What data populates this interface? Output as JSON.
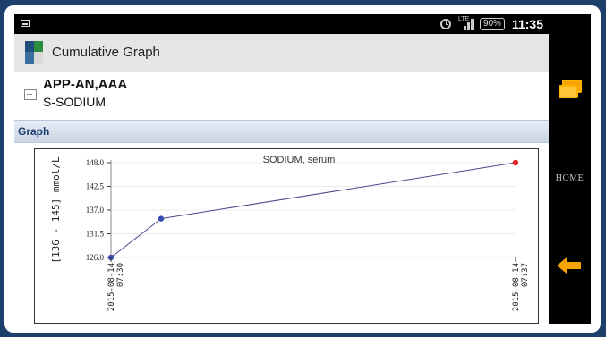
{
  "status": {
    "signal_label": "LTE",
    "battery": "90%",
    "time": "11:35"
  },
  "app": {
    "title": "Cumulative Graph"
  },
  "patient": {
    "name": "APP-AN,AAA",
    "test": "S-SODIUM"
  },
  "section": {
    "label": "Graph"
  },
  "nav": {
    "home_label": "HOME"
  },
  "colors": {
    "line": "#4a4a8a",
    "point_normal": "#3a4fb0",
    "point_latest": "#e02020",
    "section_text": "#1f3f72",
    "accent": "#f4a300"
  },
  "icons": [
    "image-icon",
    "alarm-icon",
    "signal-icon",
    "battery-icon",
    "app-icon",
    "recent-apps-icon",
    "back-arrow-icon"
  ],
  "chart_data": {
    "type": "line",
    "title": "SODIUM, serum",
    "ylabel": "[136 - 145] mmol/L",
    "yticks": [
      "148.0",
      "142.5",
      "137.0",
      "131.5",
      "126.0"
    ],
    "ylim": [
      126.0,
      148.0
    ],
    "x_labels": [
      {
        "date": "2015-08-14",
        "time": "07:30"
      },
      {
        "date": "2015-08-14",
        "time": "07:37"
      }
    ],
    "series": [
      {
        "values": [
          126,
          135,
          148
        ]
      }
    ],
    "grid": true
  }
}
